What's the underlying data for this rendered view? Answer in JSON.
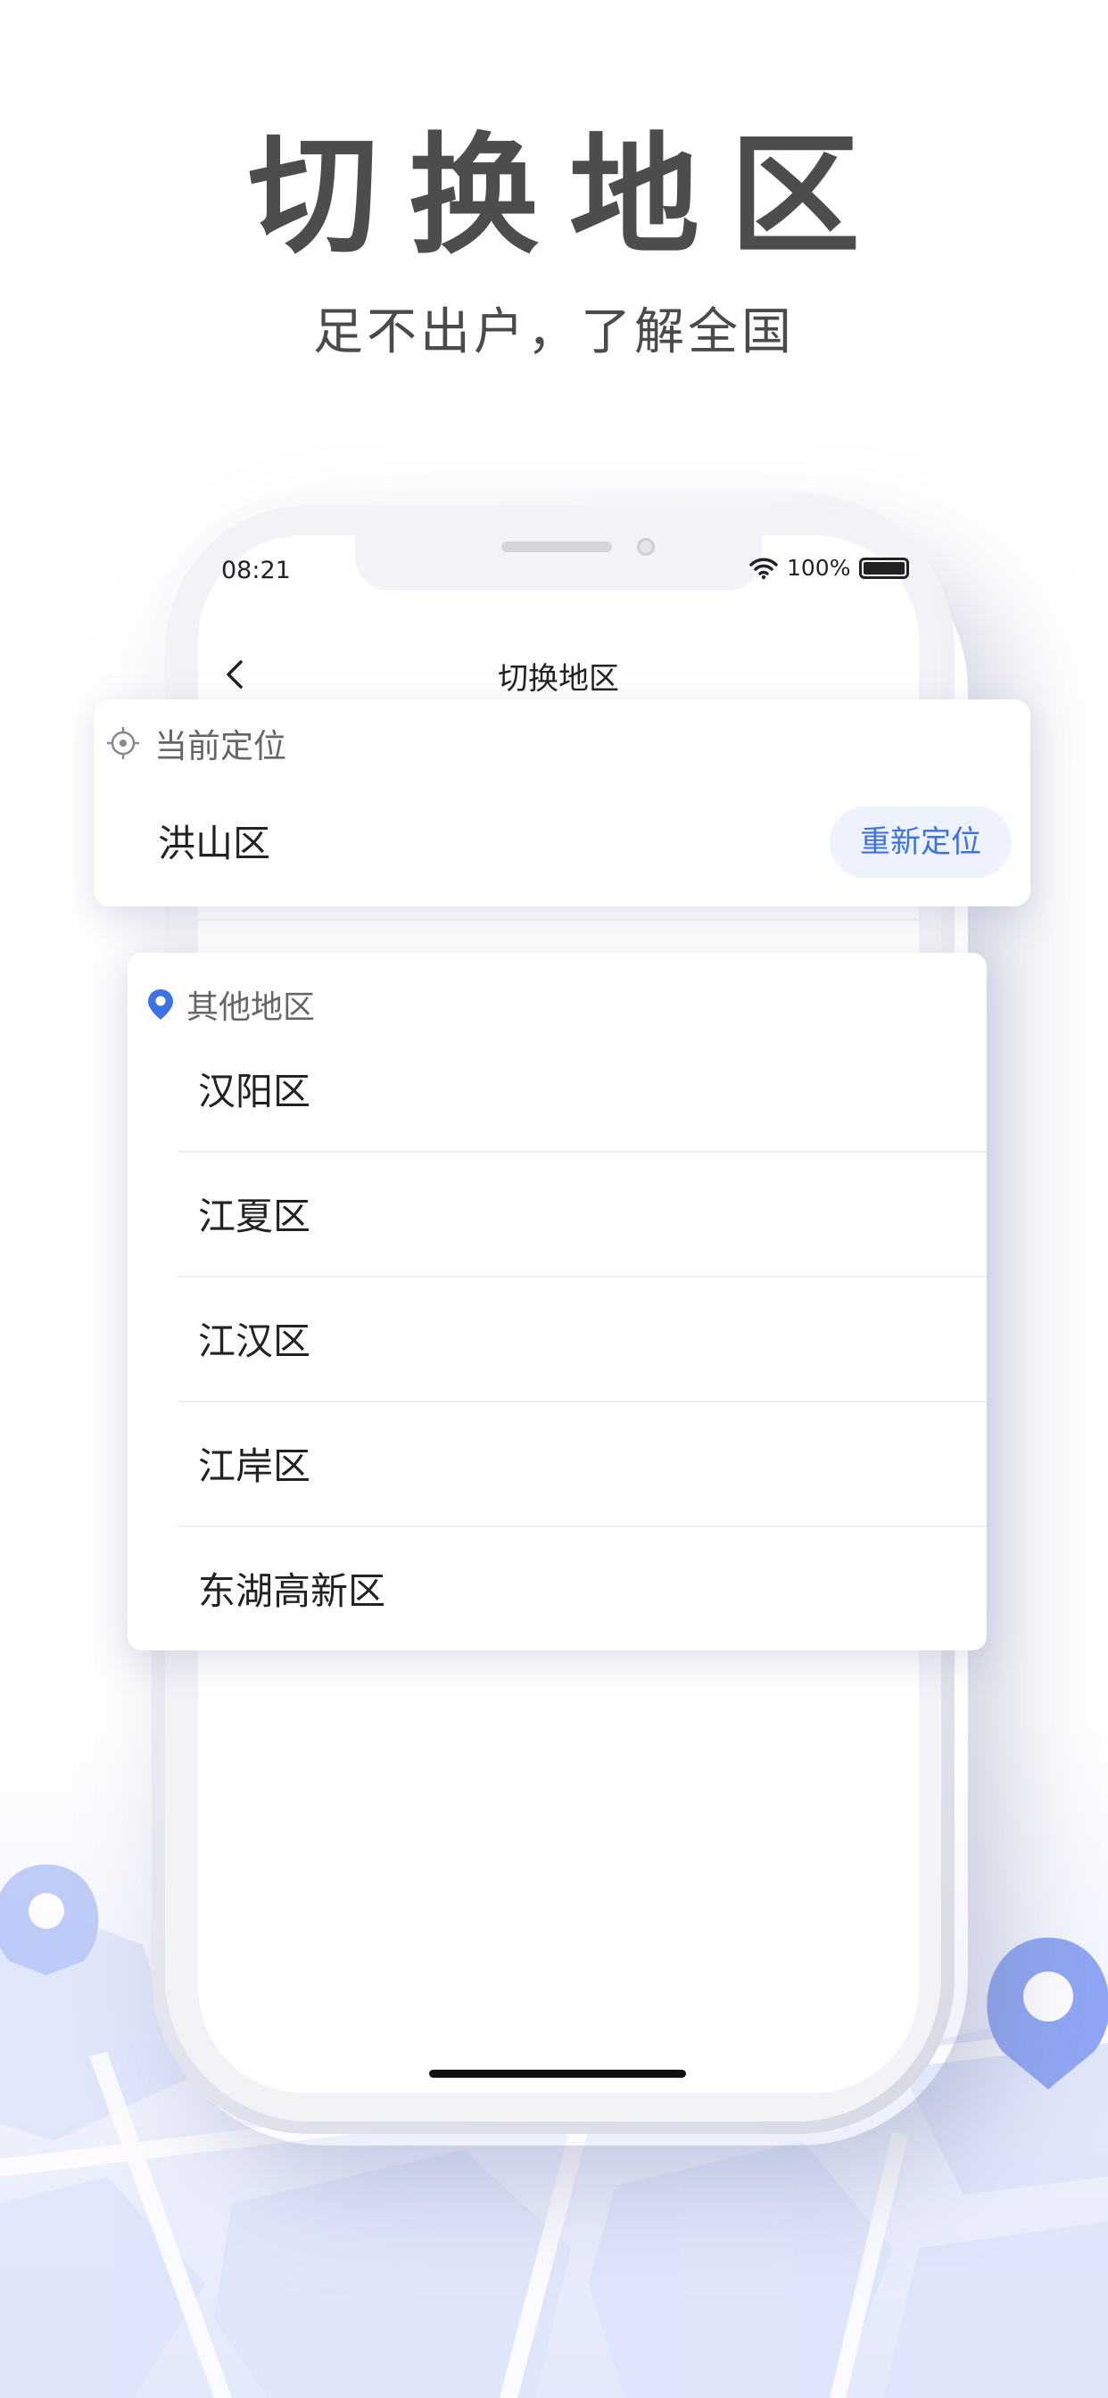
{
  "headline": {
    "title": "切换地区",
    "subtitle": "足不出户，了解全国"
  },
  "status_bar": {
    "time": "08:21",
    "battery_percent": "100%",
    "battery_level": 1.0,
    "wifi_icon": "wifi-icon"
  },
  "nav": {
    "back_icon": "chevron-left-icon",
    "title": "切换地区"
  },
  "current_location": {
    "header_icon": "locate-target-icon",
    "header_label": "当前定位",
    "district": "洪山区",
    "relocate_button": "重新定位"
  },
  "other_districts": {
    "header_icon": "location-pin-icon",
    "header_label": "其他地区",
    "items": [
      {
        "label": "汉阳区"
      },
      {
        "label": "江夏区"
      },
      {
        "label": "江汉区"
      },
      {
        "label": "江岸区"
      },
      {
        "label": "东湖高新区"
      }
    ]
  },
  "colors": {
    "accent": "#3d72e4",
    "relocate_bg": "#eef2fd",
    "map_pin": "#8fa6f3",
    "map_base": "#e6ebfb",
    "headline": "#4d4d4d"
  }
}
